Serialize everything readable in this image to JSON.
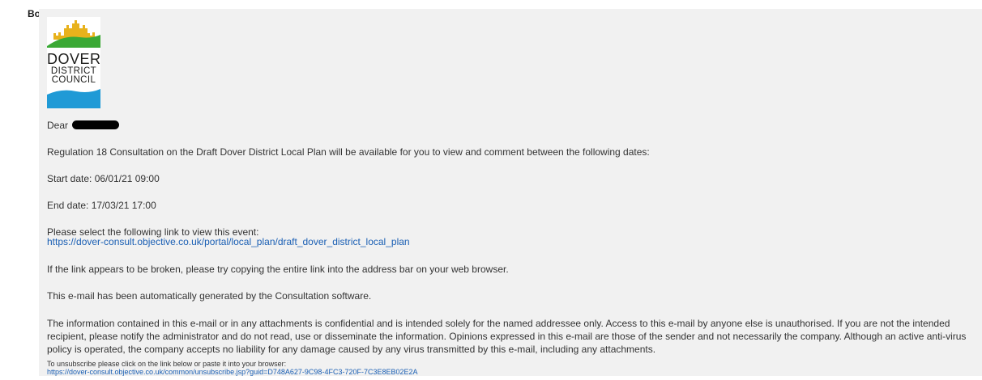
{
  "field_label": "Body",
  "logo": {
    "line1": "DOVER",
    "line2": "DISTRICT",
    "line3": "COUNCIL",
    "colors": {
      "castle": "#e8b21c",
      "hill": "#3aa935",
      "sea": "#1f9ad6"
    }
  },
  "email": {
    "greeting": "Dear",
    "intro": "Regulation 18 Consultation on the Draft Dover District Local Plan will be available for you to view and comment between the following dates:",
    "start_date": "Start date: 06/01/21 09:00",
    "end_date": "End date: 17/03/21 17:00",
    "link_prompt": "Please select the following link to view this event:",
    "event_link": "https://dover-consult.objective.co.uk/portal/local_plan/draft_dover_district_local_plan",
    "broken_link_help": "If the link appears to be broken, please try copying the entire link into the address bar on your web browser.",
    "auto_generated": "This e-mail has been automatically generated by the Consultation software.",
    "disclaimer": "The information contained in this e-mail or in any attachments is confidential and is intended solely for the named addressee only. Access to this e-mail by anyone else is unauthorised. If you are not the intended recipient, please notify the administrator and do not read, use or disseminate the information. Opinions expressed in this e-mail are those of the sender and not necessarily the company. Although an active anti-virus policy is operated, the company accepts no liability for any damage caused by any virus transmitted by this e-mail, including any attachments.",
    "unsubscribe_label": "To unsubscribe please click on the link below or paste it into your browser:",
    "unsubscribe_link": "https://dover-consult.objective.co.uk/common/unsubscribe.jsp?guid=D748A627-9C98-4FC3-720F-7C3E8EB02E2A"
  },
  "colors": {
    "panel_background": "#f1f1f1",
    "link": "#1a5fb4",
    "text": "#333333"
  }
}
